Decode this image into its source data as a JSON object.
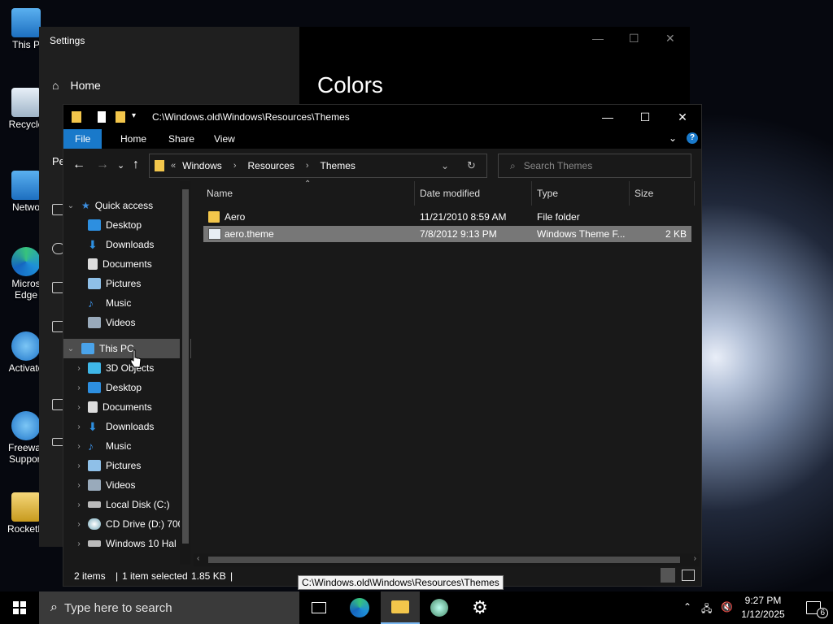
{
  "desktop": {
    "icons": [
      {
        "label": "This P"
      },
      {
        "label": "Recycle"
      },
      {
        "label": "Netwo"
      },
      {
        "label": "Micros Edge"
      },
      {
        "label": "Activato"
      },
      {
        "label": "Freewar Support"
      },
      {
        "label": "RocketD"
      }
    ]
  },
  "settings": {
    "title": "Settings",
    "home": "Home",
    "heading": "Colors",
    "sidebar_partial": "Pe"
  },
  "explorer": {
    "title_path": "C:\\Windows.old\\Windows\\Resources\\Themes",
    "ribbon_tabs": [
      "File",
      "Home",
      "Share",
      "View"
    ],
    "breadcrumb": [
      "Windows",
      "Resources",
      "Themes"
    ],
    "breadcrumb_prefix": "«",
    "search_placeholder": "Search Themes",
    "nav": {
      "quick_access": "Quick access",
      "quick_items": [
        "Desktop",
        "Downloads",
        "Documents",
        "Pictures",
        "Music",
        "Videos"
      ],
      "this_pc": "This PC",
      "pc_items": [
        "3D Objects",
        "Desktop",
        "Documents",
        "Downloads",
        "Music",
        "Pictures",
        "Videos",
        "Local Disk (C:)",
        "CD Drive (D:) 700",
        "Windows 10 Hal"
      ]
    },
    "columns": [
      "Name",
      "Date modified",
      "Type",
      "Size"
    ],
    "files": [
      {
        "name": "Aero",
        "date": "11/21/2010 8:59 AM",
        "type": "File folder",
        "size": ""
      },
      {
        "name": "aero.theme",
        "date": "7/8/2012 9:13 PM",
        "type": "Windows Theme F...",
        "size": "2 KB"
      }
    ],
    "status": {
      "items": "2 items",
      "selected": "1 item selected",
      "size": "1.85 KB"
    },
    "tooltip": "C:\\Windows.old\\Windows\\Resources\\Themes"
  },
  "taskbar": {
    "search_placeholder": "Type here to search",
    "time": "9:27 PM",
    "date": "1/12/2025",
    "notification_count": "6"
  },
  "colors": {
    "accent": "#1979ca",
    "selected_row": "#777777",
    "folder": "#f3c64b"
  }
}
